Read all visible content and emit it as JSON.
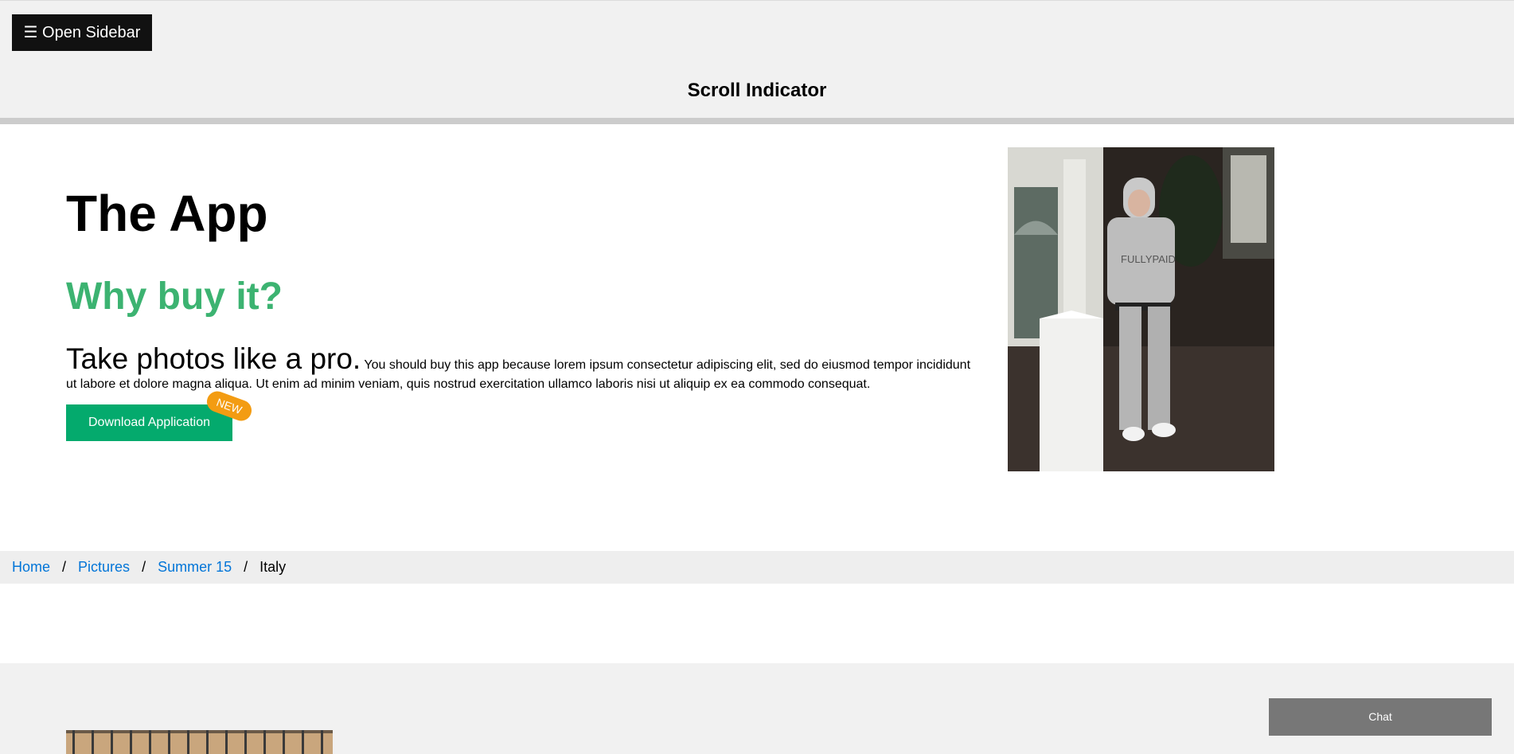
{
  "header": {
    "open_sidebar_label": "☰ Open Sidebar",
    "title": "Scroll Indicator"
  },
  "progress": {
    "percent": 0
  },
  "hero": {
    "title": "The App",
    "subtitle": "Why buy it?",
    "lead": "Take photos like a pro.",
    "body": " You should buy this app because lorem ipsum consectetur adipiscing elit, sed do eiusmod tempor incididunt ut labore et dolore magna aliqua. Ut enim ad minim veniam, quis nostrud exercitation ullamco laboris nisi ut aliquip ex ea commodo consequat.",
    "download_label": "Download Application",
    "badge": "NEW"
  },
  "breadcrumb": {
    "items": [
      "Home",
      "Pictures",
      "Summer 15"
    ],
    "current": "Italy",
    "separator": "/"
  },
  "chat": {
    "label": "Chat"
  },
  "colors": {
    "accent": "#04AA6D",
    "subtitle": "#3cb371",
    "badge": "#f39c12",
    "link": "#0275d8"
  }
}
